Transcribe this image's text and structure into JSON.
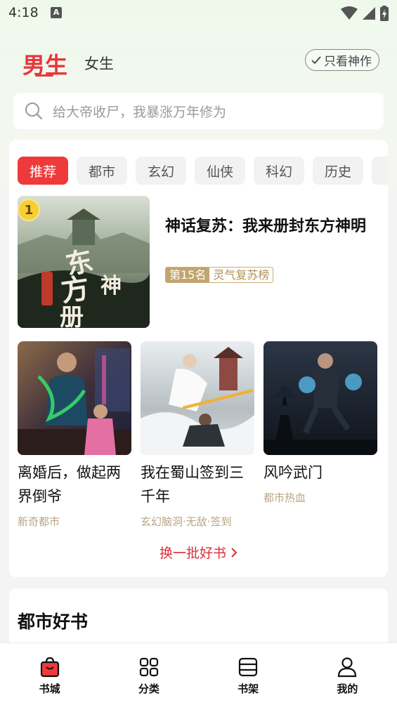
{
  "status_bar": {
    "time": "4:18",
    "notification_glyph": "A"
  },
  "gender_tabs": {
    "male": "男生",
    "female": "女生"
  },
  "filter_button": {
    "label": "只看神作"
  },
  "search": {
    "placeholder": "给大帝收尸，我暴涨万年修为"
  },
  "categories": [
    "推荐",
    "都市",
    "玄幻",
    "仙侠",
    "科幻",
    "历史"
  ],
  "featured": {
    "rank_badge": "1",
    "title": "神话复苏：我来册封东方神明",
    "rank_label": "第15名",
    "rank_list": "灵气复苏榜"
  },
  "books": [
    {
      "title": "离婚后，做起两界倒爷",
      "tag": "新奇都市"
    },
    {
      "title": "我在蜀山签到三千年",
      "tag": "玄幻脑洞·无敌·签到"
    },
    {
      "title": "风吟武门",
      "tag": "都市热血"
    }
  ],
  "more_link": "换一批好书",
  "section2": {
    "title": "都市好书"
  },
  "bottom_nav": [
    {
      "label": "书城",
      "icon": "bag-icon",
      "active": true
    },
    {
      "label": "分类",
      "icon": "grid-icon",
      "active": false
    },
    {
      "label": "书架",
      "icon": "bookshelf-icon",
      "active": false
    },
    {
      "label": "我的",
      "icon": "profile-icon",
      "active": false
    }
  ],
  "colors": {
    "accent": "#e8363b",
    "tag": "#b9a583",
    "rank": "#c3a46f"
  }
}
